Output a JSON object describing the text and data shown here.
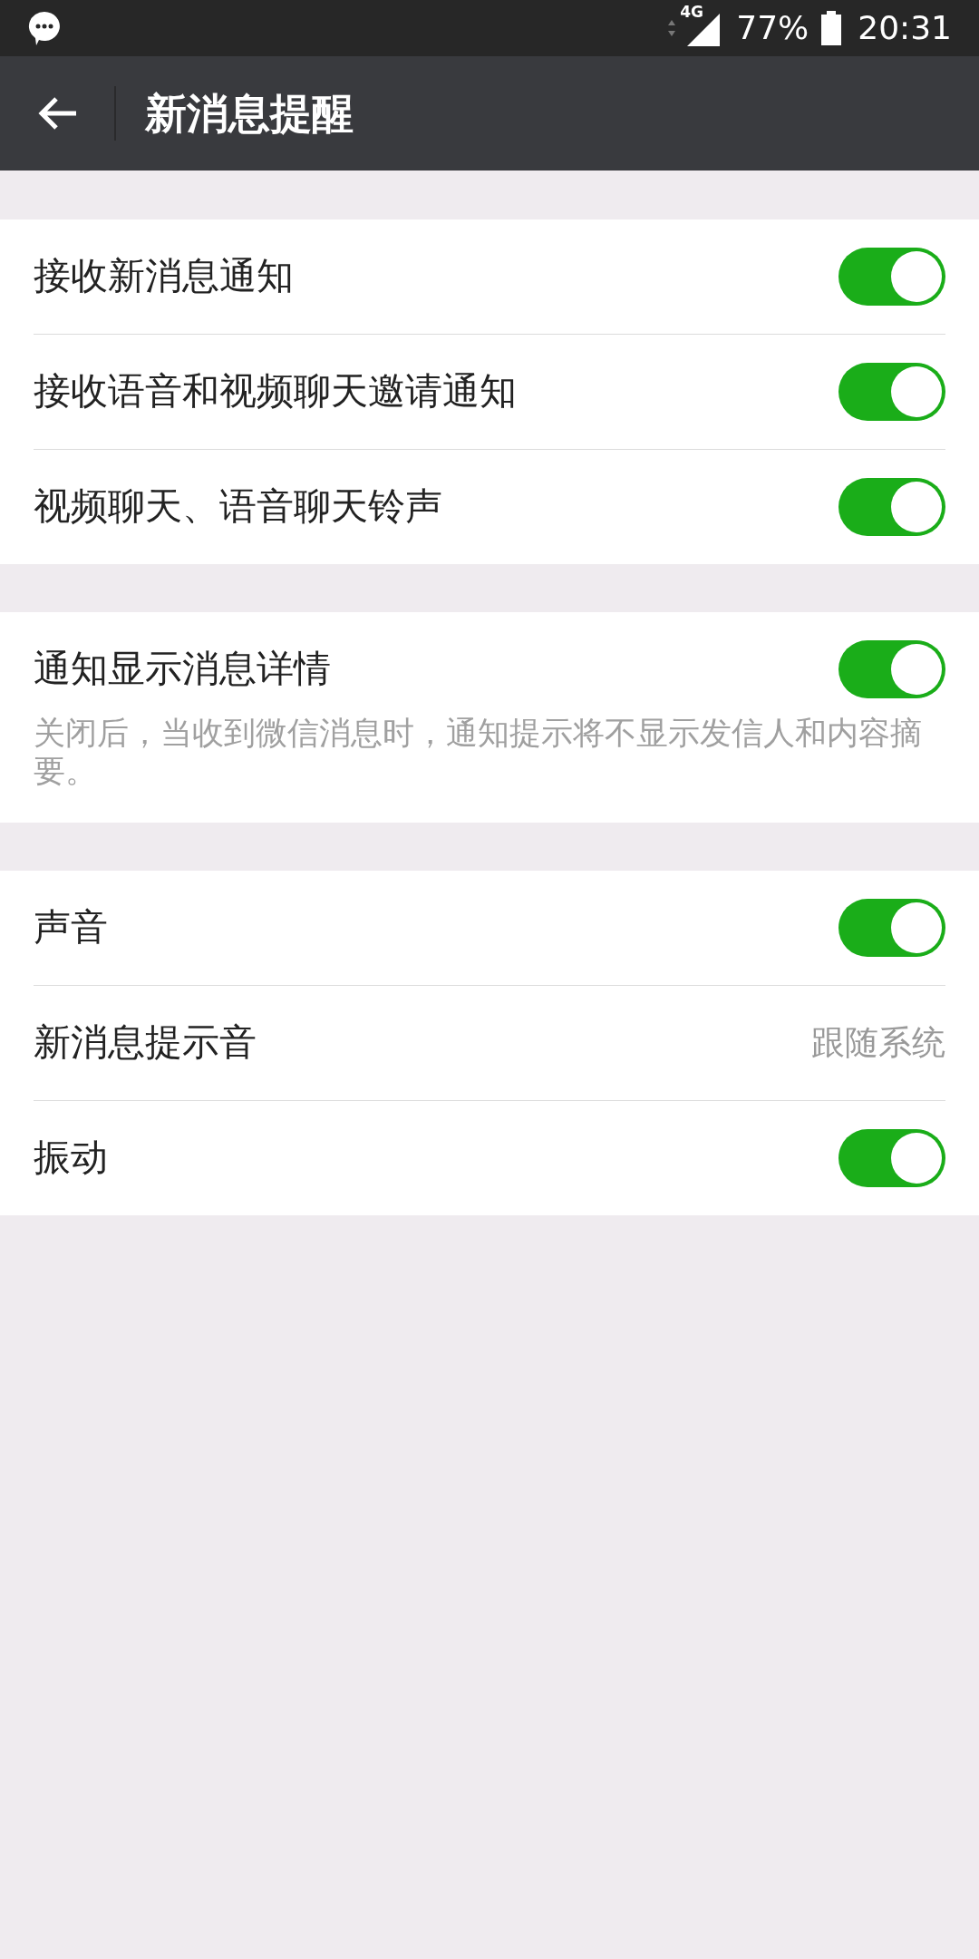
{
  "status_bar": {
    "network": "4G",
    "battery": "77%",
    "time": "20:31"
  },
  "app_bar": {
    "title": "新消息提醒"
  },
  "sections": [
    {
      "rows": [
        {
          "kind": "toggle",
          "label": "接收新消息通知",
          "on": true
        },
        {
          "kind": "toggle",
          "label": "接收语音和视频聊天邀请通知",
          "on": true
        },
        {
          "kind": "toggle",
          "label": "视频聊天、语音聊天铃声",
          "on": true
        }
      ]
    },
    {
      "rows": [
        {
          "kind": "toggle",
          "label": "通知显示消息详情",
          "on": true,
          "note": "关闭后，当收到微信消息时，通知提示将不显示发信人和内容摘要。"
        }
      ]
    },
    {
      "rows": [
        {
          "kind": "toggle",
          "label": "声音",
          "on": true
        },
        {
          "kind": "value",
          "label": "新消息提示音",
          "value": "跟随系统"
        },
        {
          "kind": "toggle",
          "label": "振动",
          "on": true
        }
      ]
    }
  ]
}
